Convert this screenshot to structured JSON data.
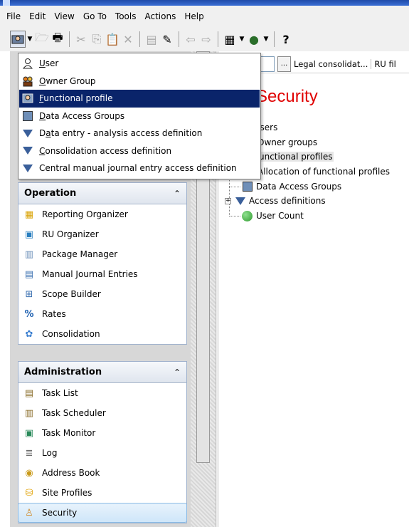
{
  "menubar": [
    "File",
    "Edit",
    "View",
    "Go To",
    "Tools",
    "Actions",
    "Help"
  ],
  "toolbar": {
    "buttons": [
      "new-user-icon",
      "dropdown-arrow-icon",
      "open-folder-icon",
      "print-icon",
      "cut-icon",
      "copy-icon",
      "paste-icon",
      "delete-icon",
      "properties-icon",
      "edit-icon",
      "back-arrow-icon",
      "forward-arrow-icon",
      "grid-view-icon",
      "globe-icon",
      "help-icon"
    ]
  },
  "dropdown_menu": {
    "items": [
      {
        "label": "User",
        "mnemonic": "U",
        "icon": "user-icon"
      },
      {
        "label": "Owner Group",
        "mnemonic": "O",
        "icon": "owner-group-icon"
      },
      {
        "label": "Functional profile",
        "mnemonic": "F",
        "icon": "functional-profile-icon",
        "active": true
      },
      {
        "label": "Data Access Groups",
        "mnemonic": "D",
        "icon": "data-access-group-icon"
      },
      {
        "label": "Data entry - analysis access definition",
        "mnemonic": "a",
        "icon": "funnel-icon"
      },
      {
        "label": "Consolidation access definition",
        "mnemonic": "C",
        "icon": "funnel-icon"
      },
      {
        "label": "Central manual journal entry access definition",
        "mnemonic": "",
        "icon": "funnel-icon"
      }
    ]
  },
  "operation_panel": {
    "title": "Operation",
    "items": [
      {
        "label": "Reporting Organizer",
        "icon": "reporting-organizer-icon"
      },
      {
        "label": "RU Organizer",
        "icon": "ru-organizer-icon"
      },
      {
        "label": "Package Manager",
        "icon": "package-manager-icon"
      },
      {
        "label": "Manual Journal Entries",
        "icon": "journal-entries-icon"
      },
      {
        "label": "Scope Builder",
        "icon": "scope-builder-icon"
      },
      {
        "label": "Rates",
        "icon": "rates-icon"
      },
      {
        "label": "Consolidation",
        "icon": "consolidation-icon"
      }
    ]
  },
  "administration_panel": {
    "title": "Administration",
    "items": [
      {
        "label": "Task List",
        "icon": "task-list-icon"
      },
      {
        "label": "Task Scheduler",
        "icon": "task-scheduler-icon"
      },
      {
        "label": "Task Monitor",
        "icon": "task-monitor-icon"
      },
      {
        "label": "Log",
        "icon": "log-icon"
      },
      {
        "label": "Address Book",
        "icon": "address-book-icon"
      },
      {
        "label": "Site Profiles",
        "icon": "site-profiles-icon"
      },
      {
        "label": "Security",
        "icon": "security-icon",
        "selected": true
      }
    ]
  },
  "filter_bar": {
    "ellipsis": "...",
    "label1": "Legal consolidat...",
    "label2": "RU fil"
  },
  "right_pane": {
    "title": "Security",
    "tree": [
      {
        "label": "Jsers"
      },
      {
        "label": "Owner groups"
      },
      {
        "label": "unctional profiles",
        "highlighted": true
      },
      {
        "label": "Allocation of functional profiles"
      },
      {
        "label": "Data Access Groups",
        "icon": "data-access-group-icon"
      },
      {
        "label": "Access definitions",
        "icon": "funnel-icon",
        "expander": "+"
      },
      {
        "label": "User Count",
        "icon": "green-dot-icon"
      }
    ]
  },
  "colors": {
    "menu_highlight": "#0a246a",
    "title_red": "#e00000",
    "selected_item": "#cfe6f9"
  }
}
